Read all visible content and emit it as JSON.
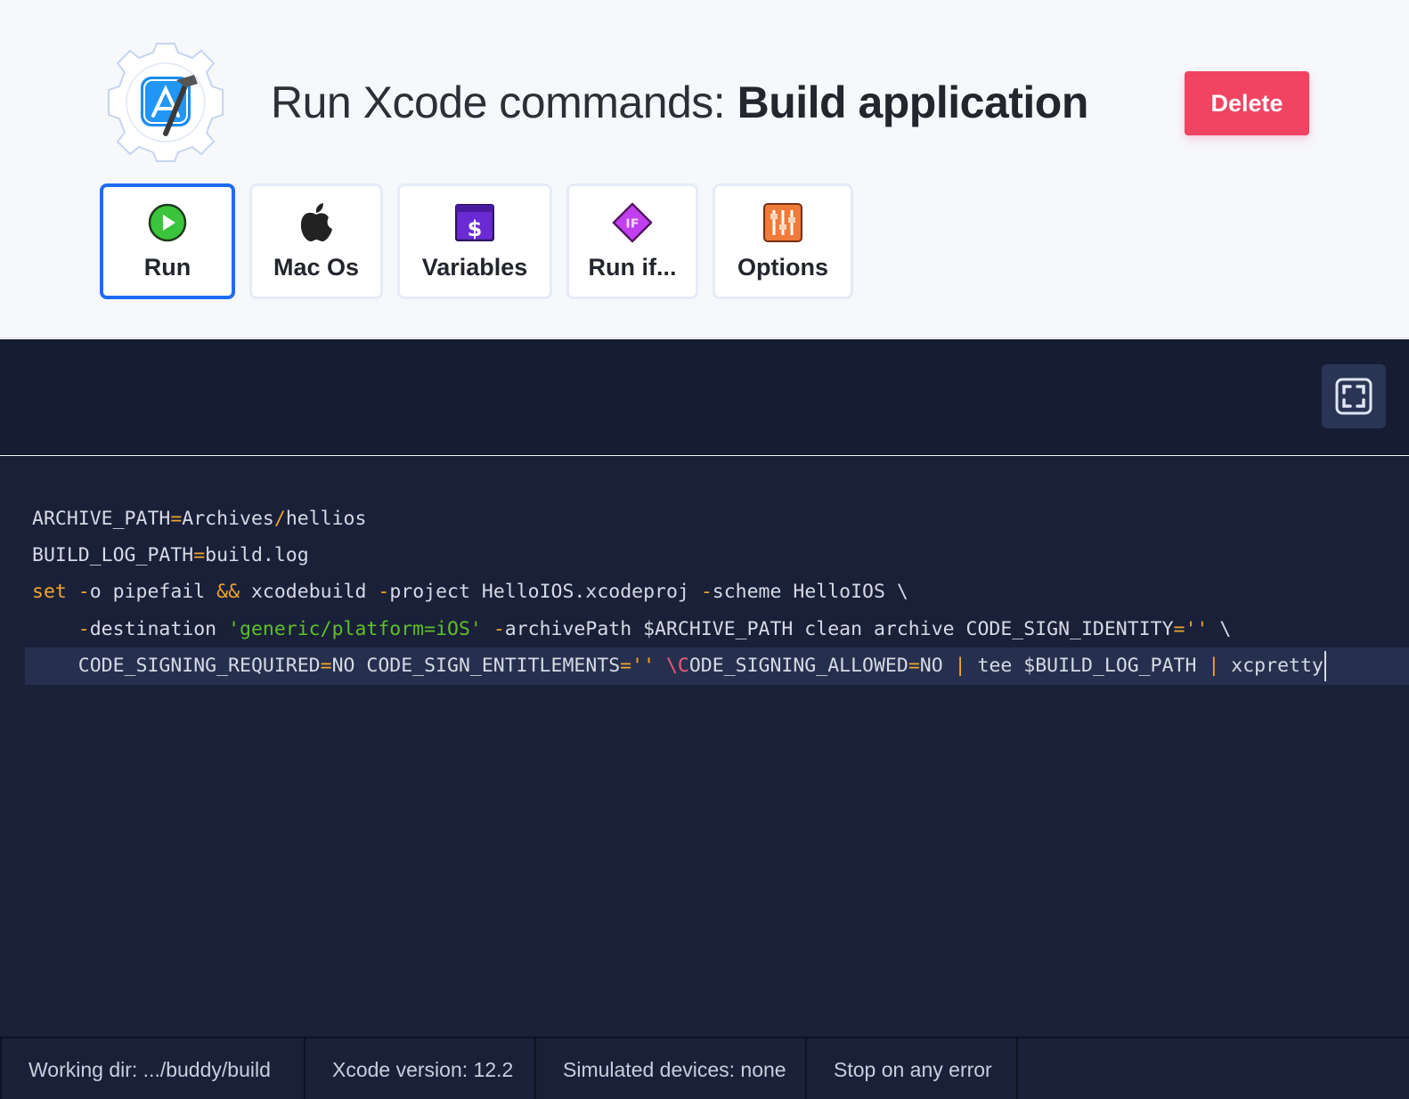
{
  "header": {
    "title_prefix": "Run Xcode commands: ",
    "title_action": "Build application",
    "delete_label": "Delete",
    "logo_icon": "xcode-gear-icon"
  },
  "tabs": [
    {
      "label": "Run",
      "icon": "play-circle-icon",
      "active": true
    },
    {
      "label": "Mac Os",
      "icon": "apple-icon",
      "active": false
    },
    {
      "label": "Variables",
      "icon": "dollar-variable-icon",
      "active": false
    },
    {
      "label": "Run if...",
      "icon": "if-diamond-icon",
      "active": false
    },
    {
      "label": "Options",
      "icon": "sliders-icon",
      "active": false
    }
  ],
  "editor": {
    "fullscreen_icon": "fullscreen-icon",
    "lines": [
      "ARCHIVE_PATH=Archives/hellios",
      "BUILD_LOG_PATH=build.log",
      "set -o pipefail && xcodebuild -project HelloIOS.xcodeproj -scheme HelloIOS \\",
      "    -destination 'generic/platform=iOS' -archivePath $ARCHIVE_PATH clean archive CODE_SIGN_IDENTITY='' \\",
      "    CODE_SIGNING_REQUIRED=NO CODE_SIGN_ENTITLEMENTS='' \\CODE_SIGNING_ALLOWED=NO | tee $BUILD_LOG_PATH | xcpretty"
    ]
  },
  "statusbar": {
    "working_dir": "Working dir: .../buddy/build",
    "xcode_version": "Xcode version: 12.2",
    "simulated_devices": "Simulated devices: none",
    "error_mode": "Stop on any error"
  },
  "colors": {
    "accent": "#1e6cf5",
    "danger": "#f04462",
    "editor_bg": "#1a2038",
    "operator": "#f0a530",
    "string": "#5cc02a"
  }
}
